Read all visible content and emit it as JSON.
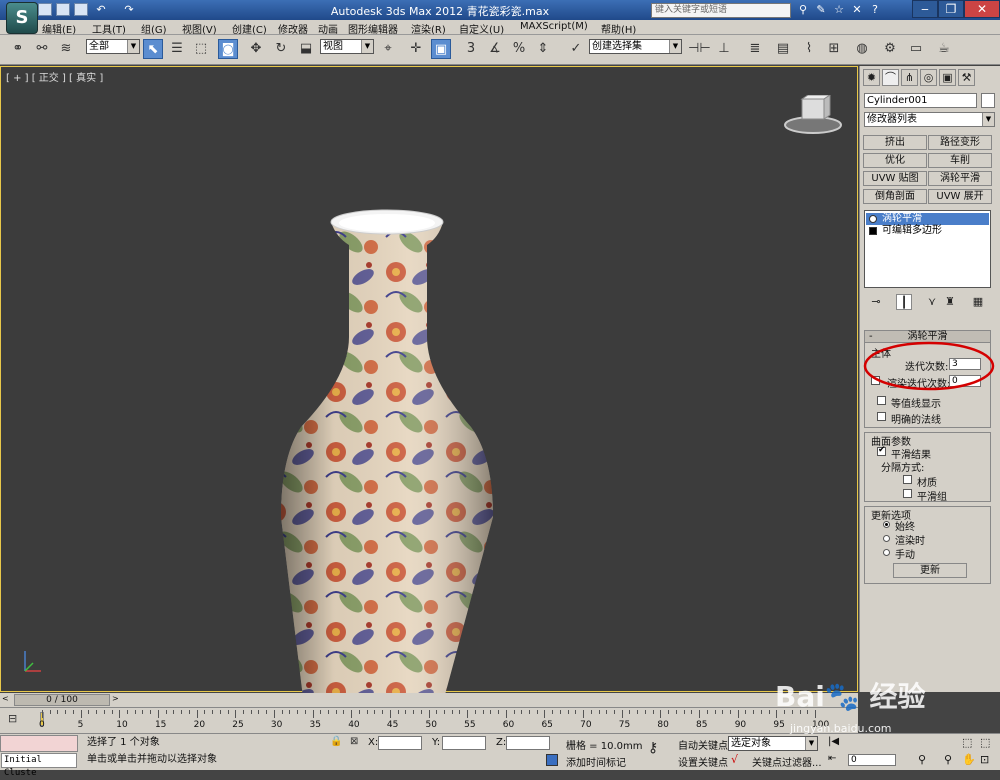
{
  "title": "Autodesk 3ds Max  2012  青花瓷彩瓷.max",
  "search_placeholder": "键入关键字或短语",
  "menu": [
    "编辑(E)",
    "工具(T)",
    "组(G)",
    "视图(V)",
    "创建(C)",
    "修改器",
    "动画",
    "图形编辑器",
    "渲染(R)",
    "自定义(U)",
    "MAXScript(M)",
    "帮助(H)"
  ],
  "toolbar": {
    "selection_filter": "全部",
    "ref_coord": "视图",
    "named_selection": "创建选择集",
    "snap_label": "3",
    "percent": "%"
  },
  "viewport": {
    "label": "[ + ] [ 正交 ] [ 真实 ]"
  },
  "panel": {
    "object_name": "Cylinder001",
    "modifier_list": "修改器列表",
    "modifier_buttons": [
      "挤出",
      "路径变形",
      "优化",
      "车削",
      "UVW 贴图",
      "涡轮平滑",
      "倒角剖面",
      "UVW 展开"
    ],
    "stack": [
      "涡轮平滑",
      "可编辑多边形"
    ],
    "rollout_title": "涡轮平滑",
    "main_group": "主体",
    "iterations_label": "迭代次数:",
    "iterations_value": "3",
    "render_iters_label": "渲染迭代次数:",
    "render_iters_value": "0",
    "isoline_label": "等值线显示",
    "explicit_normals_label": "明确的法线",
    "surface_group": "曲面参数",
    "smooth_result_label": "平滑结果",
    "separate_label": "分隔方式:",
    "material_label": "材质",
    "smoothing_groups_label": "平滑组",
    "update_group": "更新选项",
    "always_label": "始终",
    "when_render_label": "渲染时",
    "manual_label": "手动",
    "update_button": "更新"
  },
  "timeline": {
    "slider": "0 / 100",
    "ticks": [
      "0",
      "5",
      "10",
      "15",
      "20",
      "25",
      "30",
      "35",
      "40",
      "45",
      "50",
      "55",
      "60",
      "65",
      "70",
      "75",
      "80",
      "85",
      "90",
      "95",
      "100"
    ]
  },
  "status": {
    "maxscript": "Initial Cluste",
    "selected": "选择了 1 个对象",
    "prompt": "单击或单击并拖动以选择对象",
    "x_label": "X:",
    "y_label": "Y:",
    "z_label": "Z:",
    "grid": "栅格 = 10.0mm",
    "add_time_tag": "添加时间标记",
    "auto_key": "自动关键点",
    "set_key": "设置关键点",
    "selected_dropdown": "选定对象",
    "key_filters": "关键点过滤器...",
    "frame_value": "0"
  },
  "watermark": "jingyan.baidu.com",
  "colors": {
    "highlight_circle": "#d40000",
    "viewport_border": "#e8c84a",
    "selected_stack": "#4a7ec9"
  }
}
